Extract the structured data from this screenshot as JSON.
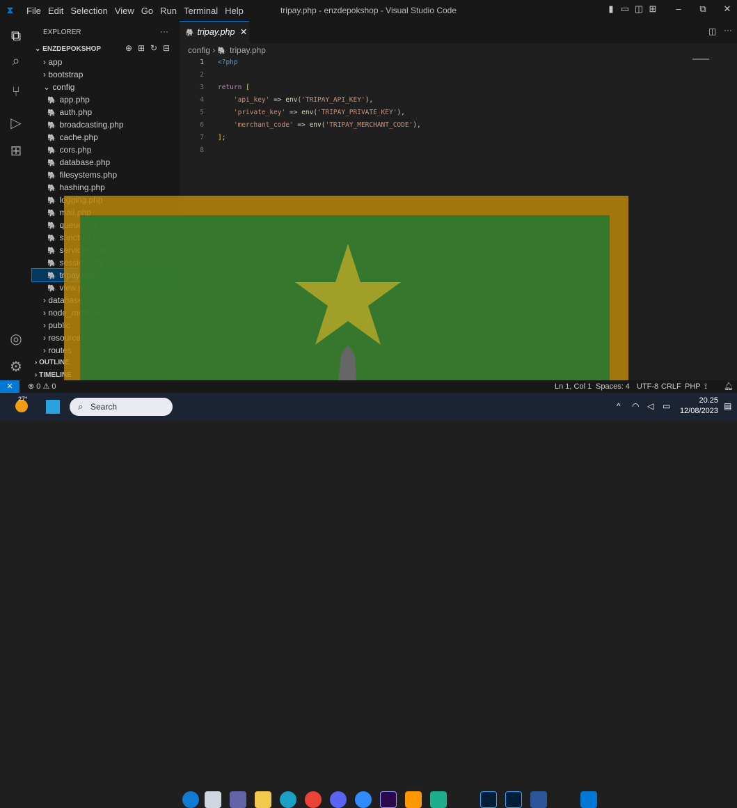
{
  "window": {
    "title": "tripay.php - enzdepokshop - Visual Studio Code",
    "menu": [
      "File",
      "Edit",
      "Selection",
      "View",
      "Go",
      "Run",
      "Terminal",
      "Help"
    ]
  },
  "sidebar": {
    "header": "EXPLORER",
    "root": "ENZDEPOKSHOP",
    "items": [
      "app",
      "bootstrap",
      "config",
      "app.php",
      "auth.php",
      "broadcasting.php",
      "cache.php",
      "cors.php",
      "database.php",
      "filesystems.php",
      "hashing.php",
      "logging.php",
      "mail.php",
      "queue.php",
      "sanctum.php",
      "services.php",
      "session.php",
      "tripay.php",
      "view.php",
      "database",
      "node_modules",
      "public",
      "resources",
      "routes"
    ],
    "outline": "OUTLINE",
    "timeline": "TIMELINE"
  },
  "editor": {
    "tab": "tripay.php",
    "breadcrumb": [
      "config",
      "tripay.php"
    ],
    "line_numbers": [
      "1",
      "2",
      "3",
      "4",
      "5",
      "6",
      "7",
      "8"
    ],
    "code": {
      "l1": "<?php",
      "l3a": "return",
      "l3b": "[",
      "l4a": "'api_key'",
      "l4b": "env",
      "l4c": "'TRIPAY_API_KEY'",
      "l5a": "'private_key'",
      "l5b": "env",
      "l5c": "'TRIPAY_PRIVATE_KEY'",
      "l6a": "'merchant_code'",
      "l6b": "env",
      "l6c": "'TRIPAY_MERCHANT_CODE'",
      "l7": "];"
    }
  },
  "status": {
    "left": "⊗ 0 ⚠ 0",
    "position": "Ln 1, Col 1",
    "spaces": "Spaces: 4",
    "encoding": "UTF-8",
    "eol": "CRLF",
    "lang": "PHP"
  },
  "taskbar": {
    "temp": "27°",
    "search": "Search",
    "time": "20.25",
    "date": "12/08/2023"
  }
}
